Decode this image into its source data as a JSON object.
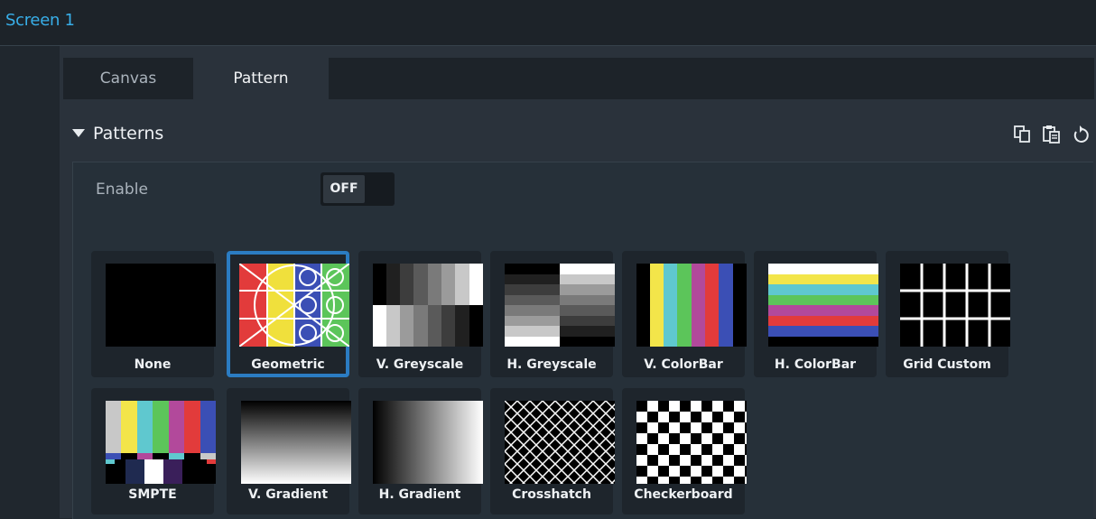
{
  "window": {
    "title": "Screen 1"
  },
  "tabs": [
    {
      "label": "Canvas",
      "active": false
    },
    {
      "label": "Pattern",
      "active": true
    }
  ],
  "section": {
    "title": "Patterns",
    "expanded": true,
    "icons": [
      "copy-icon",
      "paste-icon",
      "reset-icon"
    ]
  },
  "enable": {
    "label": "Enable",
    "toggle_value": "OFF"
  },
  "patterns": [
    {
      "label": "None",
      "selected": false,
      "icon": "none-pattern"
    },
    {
      "label": "Geometric",
      "selected": true,
      "icon": "geometric-pattern"
    },
    {
      "label": "V. Greyscale",
      "selected": false,
      "icon": "v-greyscale-pattern"
    },
    {
      "label": "H. Greyscale",
      "selected": false,
      "icon": "h-greyscale-pattern"
    },
    {
      "label": "V. ColorBar",
      "selected": false,
      "icon": "v-colorbar-pattern"
    },
    {
      "label": "H. ColorBar",
      "selected": false,
      "icon": "h-colorbar-pattern"
    },
    {
      "label": "Grid Custom",
      "selected": false,
      "icon": "grid-custom-pattern"
    },
    {
      "label": "SMPTE",
      "selected": false,
      "icon": "smpte-pattern"
    },
    {
      "label": "V. Gradient",
      "selected": false,
      "icon": "v-gradient-pattern"
    },
    {
      "label": "H. Gradient",
      "selected": false,
      "icon": "h-gradient-pattern"
    },
    {
      "label": "Crosshatch",
      "selected": false,
      "icon": "crosshatch-pattern"
    },
    {
      "label": "Checkerboard",
      "selected": false,
      "icon": "checkerboard-pattern"
    }
  ],
  "colors": {
    "accent_blue": "#38aee8",
    "selected_border": "#2b7cc2",
    "panel_bg": "#2a323b"
  }
}
